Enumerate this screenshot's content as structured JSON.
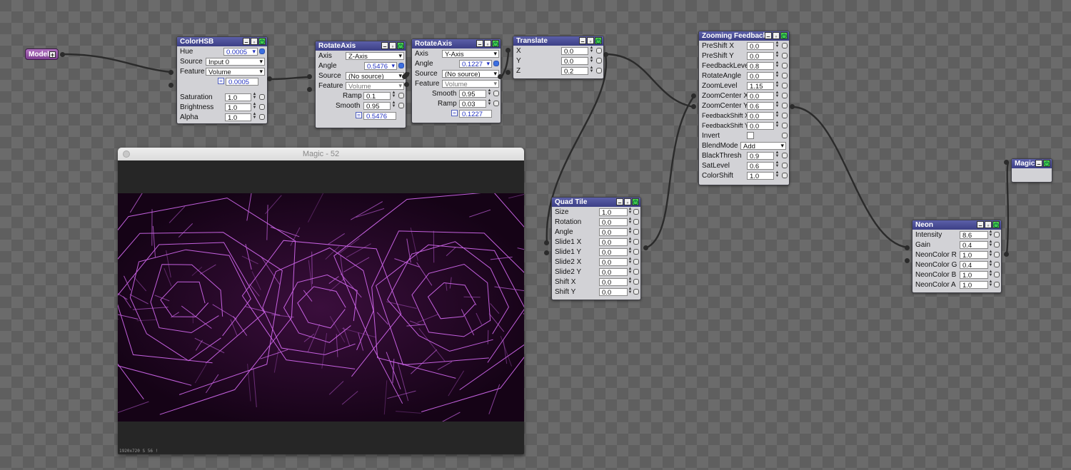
{
  "model": {
    "label": "Model"
  },
  "colorhsb": {
    "title": "ColorHSB",
    "rows": [
      {
        "label": "Hue",
        "value": "0.0005"
      },
      {
        "label": "Source",
        "value": "Input 0"
      },
      {
        "label": "Feature",
        "value": "Volume"
      },
      {
        "label": "",
        "value": "0.0005"
      },
      {
        "label": "Saturation",
        "value": "1.0"
      },
      {
        "label": "Brightness",
        "value": "1.0"
      },
      {
        "label": "Alpha",
        "value": "1.0"
      }
    ]
  },
  "rotate1": {
    "title": "RotateAxis",
    "rows": [
      {
        "label": "Axis",
        "value": "Z-Axis"
      },
      {
        "label": "Angle",
        "value": "0.5476"
      },
      {
        "label": "Source",
        "value": "(No source)"
      },
      {
        "label": "Feature",
        "value": "Volume"
      },
      {
        "label": "Ramp",
        "value": "0.1"
      },
      {
        "label": "Smooth",
        "value": "0.95"
      },
      {
        "label": "",
        "value": "0.5476"
      }
    ]
  },
  "rotate2": {
    "title": "RotateAxis",
    "rows": [
      {
        "label": "Axis",
        "value": "Y-Axis"
      },
      {
        "label": "Angle",
        "value": "0.1227"
      },
      {
        "label": "Source",
        "value": "(No source)"
      },
      {
        "label": "Feature",
        "value": "Volume"
      },
      {
        "label": "Smooth",
        "value": "0.95"
      },
      {
        "label": "Ramp",
        "value": "0.03"
      },
      {
        "label": "",
        "value": "0.1227"
      }
    ]
  },
  "translate": {
    "title": "Translate",
    "rows": [
      {
        "label": "X",
        "value": "0.0"
      },
      {
        "label": "Y",
        "value": "0.0"
      },
      {
        "label": "Z",
        "value": "0.2"
      }
    ]
  },
  "zoom": {
    "title": "Zooming Feedback",
    "rows": [
      {
        "label": "PreShift X",
        "value": "0.0"
      },
      {
        "label": "PreShift Y",
        "value": "0.0"
      },
      {
        "label": "FeedbackLevel",
        "value": "0.8"
      },
      {
        "label": "RotateAngle",
        "value": "0.0"
      },
      {
        "label": "ZoomLevel",
        "value": "1.15"
      },
      {
        "label": "ZoomCenter X",
        "value": "0.0"
      },
      {
        "label": "ZoomCenter Y",
        "value": "0.6"
      },
      {
        "label": "FeedbackShift X",
        "value": "0.0"
      },
      {
        "label": "FeedbackShift Y",
        "value": "0.0"
      },
      {
        "label": "Invert",
        "value": ""
      },
      {
        "label": "BlendMode",
        "value": "Add"
      },
      {
        "label": "BlackThresh",
        "value": "0.9"
      },
      {
        "label": "SatLevel",
        "value": "0.6"
      },
      {
        "label": "ColorShift",
        "value": "1.0"
      }
    ]
  },
  "quadtile": {
    "title": "Quad Tile",
    "rows": [
      {
        "label": "Size",
        "value": "1.0"
      },
      {
        "label": "Rotation",
        "value": "0.0"
      },
      {
        "label": "Angle",
        "value": "0.0"
      },
      {
        "label": "Slide1 X",
        "value": "0.0"
      },
      {
        "label": "Slide1 Y",
        "value": "0.0"
      },
      {
        "label": "Slide2 X",
        "value": "0.0"
      },
      {
        "label": "Slide2 Y",
        "value": "0.0"
      },
      {
        "label": "Shift X",
        "value": "0.0"
      },
      {
        "label": "Shift Y",
        "value": "0.0"
      }
    ]
  },
  "neon": {
    "title": "Neon",
    "rows": [
      {
        "label": "Intensity",
        "value": "8.6"
      },
      {
        "label": "Gain",
        "value": "0.4"
      },
      {
        "label": "NeonColor R",
        "value": "1.0"
      },
      {
        "label": "NeonColor G",
        "value": "0.4"
      },
      {
        "label": "NeonColor B",
        "value": "1.0"
      },
      {
        "label": "NeonColor A",
        "value": "1.0"
      }
    ]
  },
  "magic": {
    "title": "Magic"
  },
  "preview": {
    "title": "Magic - 52",
    "status": "1920x720 S 56 !"
  },
  "icons": {
    "minimize": "minimize-icon",
    "collapse": "collapse-icon",
    "power": "power-icon",
    "link": "link-icon",
    "plus": "plus-icon"
  },
  "colors": {
    "header": "#3c3f86",
    "node_body": "#d2d2d6",
    "model_pill": "#9a55ac",
    "wire": "#2b2b2b",
    "neon": "#e070ff"
  }
}
